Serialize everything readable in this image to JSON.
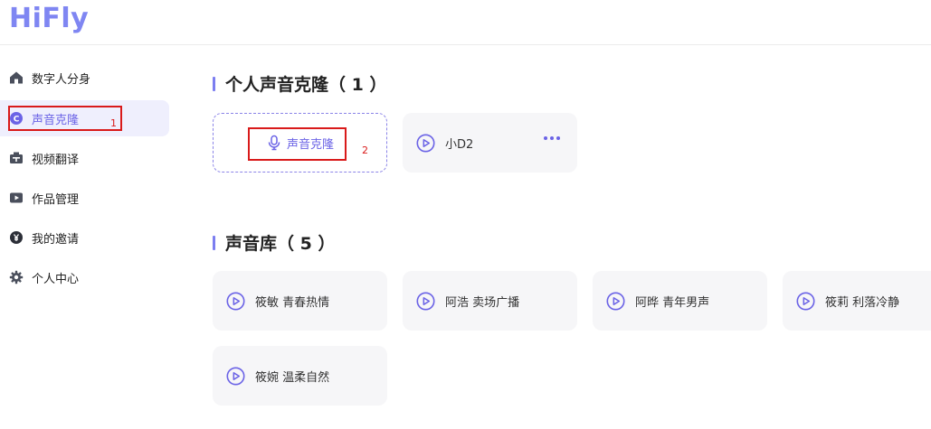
{
  "app": {
    "logo": "HiFly"
  },
  "sidebar": {
    "items": [
      {
        "label": "数字人分身",
        "icon": "home-icon"
      },
      {
        "label": "声音克隆",
        "icon": "voice-clone-icon",
        "active": true
      },
      {
        "label": "视频翻译",
        "icon": "translate-icon"
      },
      {
        "label": "作品管理",
        "icon": "video-play-icon"
      },
      {
        "label": "我的邀请",
        "icon": "invite-icon"
      },
      {
        "label": "个人中心",
        "icon": "gear-icon"
      }
    ]
  },
  "annotations": {
    "mark1": "1",
    "mark2": "2"
  },
  "personal": {
    "title": "个人声音克隆",
    "count": "（ 1 ）",
    "clone_button": "声音克隆",
    "voices": [
      {
        "name": "小D2"
      }
    ]
  },
  "library": {
    "title": "声音库",
    "count": "（ 5 ）",
    "voices": [
      {
        "name": "筱敏 青春热情"
      },
      {
        "name": "阿浩 卖场广播"
      },
      {
        "name": "阿晔 青年男声"
      },
      {
        "name": "筱莉 利落冷静"
      },
      {
        "name": "筱婉 温柔自然"
      }
    ]
  },
  "colors": {
    "accent": "#6b63e6",
    "logo": "#7f86f2",
    "annotation": "#d91a1a"
  }
}
